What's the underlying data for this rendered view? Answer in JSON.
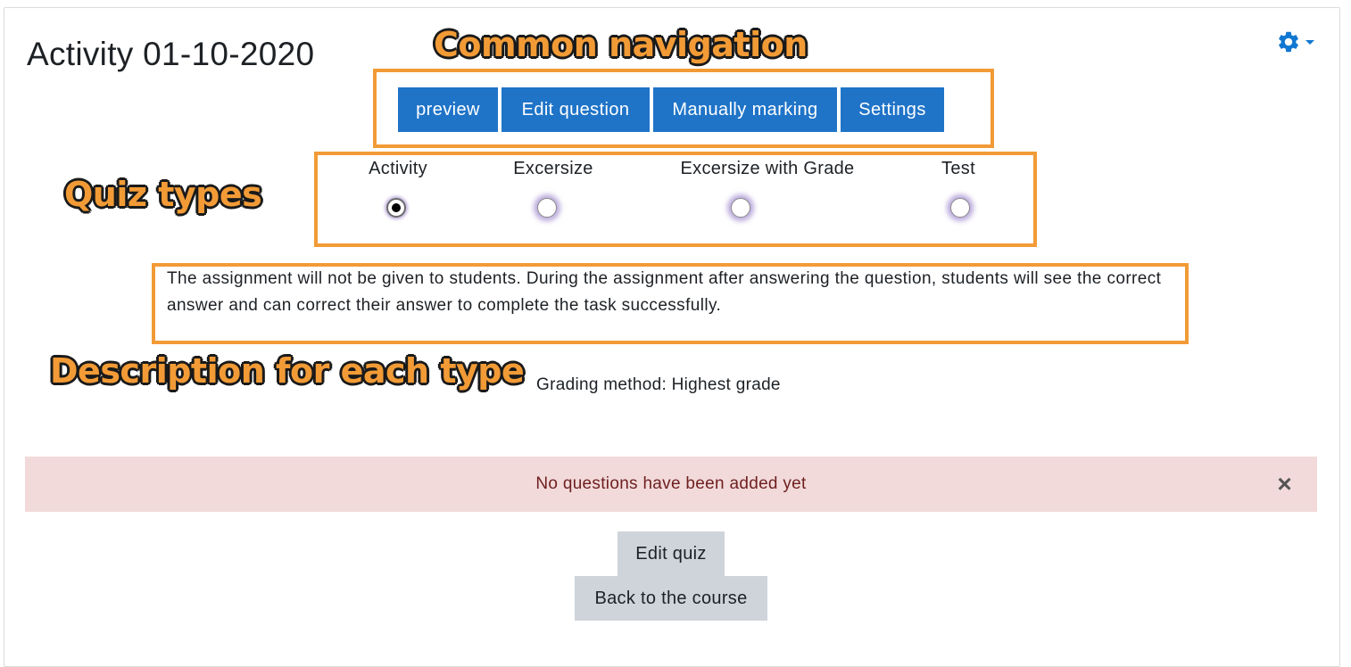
{
  "page": {
    "title": "Activity 01-10-2020"
  },
  "settings_menu": {
    "icon": "gear-icon",
    "dropdown_icon": "caret-down-icon",
    "color": "#1177d1"
  },
  "annotations": {
    "common_navigation": "Common navigation",
    "quiz_types": "Quiz types",
    "description_for_each_type": "Description for each type",
    "color": "#f29b36"
  },
  "navigation": {
    "buttons": [
      {
        "label": "preview"
      },
      {
        "label": "Edit question"
      },
      {
        "label": "Manually marking"
      },
      {
        "label": "Settings"
      }
    ],
    "color": "#1f74c8"
  },
  "quiz_types": {
    "options": [
      {
        "label": "Activity",
        "selected": true
      },
      {
        "label": "Excersize",
        "selected": false
      },
      {
        "label": "Excersize with Grade",
        "selected": false
      },
      {
        "label": "Test",
        "selected": false
      }
    ]
  },
  "description": {
    "text": "The assignment will not be given to students. During the assignment after answering the question, students will see the correct answer and can correct their answer to complete the task successfully."
  },
  "grading": {
    "text": "Grading method: Highest grade"
  },
  "alert": {
    "message": "No questions have been added yet",
    "close_symbol": "×",
    "background": "#f2dada"
  },
  "actions": {
    "edit_quiz": "Edit quiz",
    "back_to_course": "Back to the course"
  }
}
